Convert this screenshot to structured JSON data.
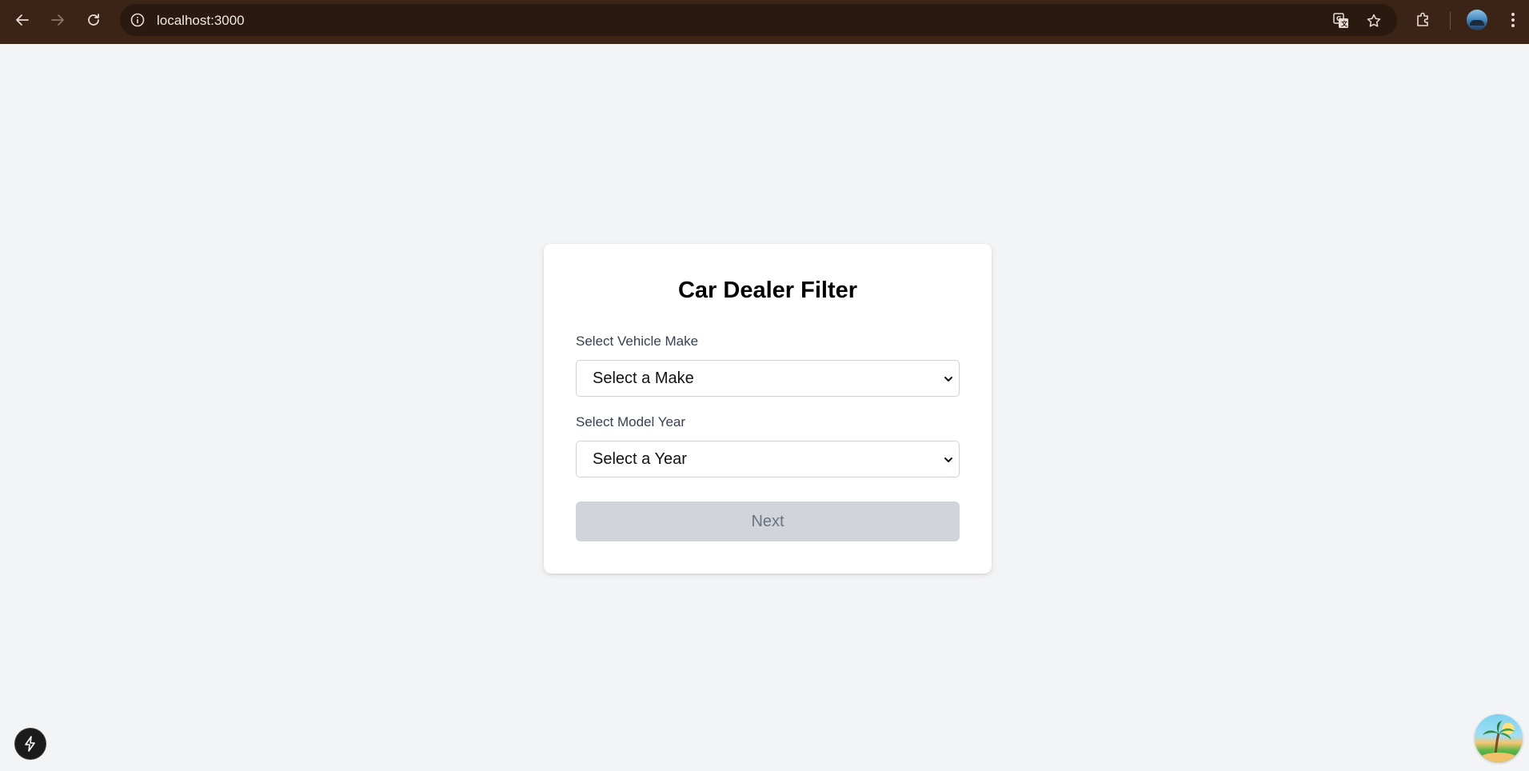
{
  "browser": {
    "url": "localhost:3000",
    "icons": {
      "back": "arrow-left-icon",
      "forward": "arrow-right-icon",
      "reload": "reload-icon",
      "site_info": "info-icon",
      "translate": "translate-icon",
      "bookmark": "star-icon",
      "extensions": "puzzle-icon",
      "profile": "avatar",
      "menu": "kebab-menu-icon"
    },
    "colors": {
      "chrome_bg": "#3b2315",
      "omnibox_bg": "#2a190f"
    }
  },
  "form": {
    "title": "Car Dealer Filter",
    "make_label": "Select Vehicle Make",
    "make_value": "Select a Make",
    "year_label": "Select Model Year",
    "year_value": "Select a Year",
    "next_label": "Next",
    "next_disabled": true
  },
  "colors": {
    "page_bg": "#f3f4f6",
    "card_bg": "#ffffff",
    "button_disabled_bg": "#d1d5db",
    "button_disabled_text": "#6b7280"
  }
}
